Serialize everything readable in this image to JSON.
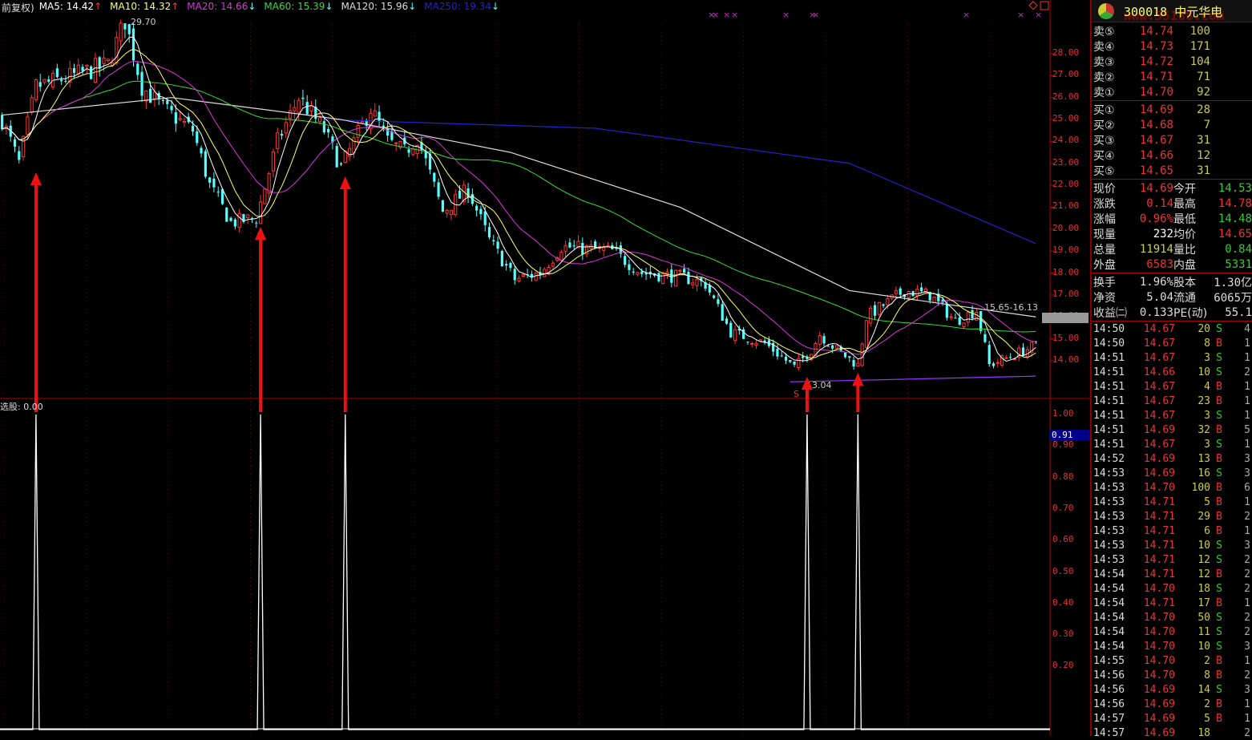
{
  "legend": {
    "prefix": "前复权)",
    "items": [
      {
        "label": "MA5: 14.42",
        "color": "#ffffff",
        "dir": "up"
      },
      {
        "label": "MA10: 14.32",
        "color": "#ffff66",
        "dir": "up"
      },
      {
        "label": "MA20: 14.66",
        "color": "#dd33dd",
        "dir": "down"
      },
      {
        "label": "MA60: 15.39",
        "color": "#33dd33",
        "dir": "down"
      },
      {
        "label": "MA120: 15.96",
        "color": "#dddddd",
        "dir": "down"
      },
      {
        "label": "MA250: 19.34",
        "color": "#2222cc",
        "dir": "down"
      }
    ]
  },
  "indicator": {
    "title": "选股: 0.00",
    "highlight": "0.91"
  },
  "annotations": {
    "high": "29.70",
    "low": "13.04",
    "range": "15.65-16.13",
    "s_marker": "S"
  },
  "chart_data": {
    "type": "candlestick",
    "price_axis": {
      "ticks": [
        28,
        27,
        26,
        25,
        24,
        23,
        22,
        21,
        20,
        19,
        18,
        17,
        16,
        15,
        14
      ],
      "labels": [
        "28.00",
        "27.00",
        "26.00",
        "25.00",
        "24.00",
        "23.00",
        "22.00",
        "21.00",
        "20.00",
        "19.00",
        "18.00",
        "17.00",
        "16.00",
        "15.00",
        "14.00"
      ]
    },
    "indicator_axis": {
      "ticks": [
        1,
        0.9,
        0.8,
        0.7,
        0.6,
        0.5,
        0.4,
        0.3,
        0.2
      ],
      "labels": [
        "1.00",
        "0.90",
        "0.80",
        "0.70",
        "0.60",
        "0.50",
        "0.40",
        "0.30",
        "0.20"
      ]
    },
    "candle_count": 245,
    "price_path": [
      [
        0,
        25
      ],
      [
        4,
        23
      ],
      [
        8,
        26.5
      ],
      [
        17,
        27
      ],
      [
        25,
        27.5
      ],
      [
        29,
        29.5
      ],
      [
        33,
        26.5
      ],
      [
        38,
        25.5
      ],
      [
        45,
        24.5
      ],
      [
        49,
        22
      ],
      [
        54,
        20.3
      ],
      [
        60,
        20.5
      ],
      [
        65,
        24
      ],
      [
        70,
        26
      ],
      [
        76,
        24.5
      ],
      [
        80,
        22.8
      ],
      [
        87,
        25.5
      ],
      [
        91,
        24
      ],
      [
        95,
        23.5
      ],
      [
        98,
        24.2
      ],
      [
        104,
        20.8
      ],
      [
        110,
        21.8
      ],
      [
        115,
        19.5
      ],
      [
        121,
        17.7
      ],
      [
        127,
        18
      ],
      [
        132,
        19.2
      ],
      [
        144,
        19
      ],
      [
        151,
        18
      ],
      [
        161,
        17.8
      ],
      [
        166,
        17.5
      ],
      [
        172,
        15.3
      ],
      [
        180,
        14.8
      ],
      [
        187,
        13.7
      ],
      [
        191,
        14.5
      ],
      [
        193,
        15.2
      ],
      [
        197,
        14.5
      ],
      [
        202,
        13.8
      ],
      [
        204,
        16
      ],
      [
        213,
        17.2
      ],
      [
        219,
        17
      ],
      [
        225,
        15.8
      ],
      [
        230,
        16.3
      ],
      [
        233,
        13.8
      ],
      [
        238,
        14.2
      ],
      [
        244,
        14.7
      ]
    ],
    "ma120_path": [
      [
        0,
        25.2
      ],
      [
        40,
        26
      ],
      [
        80,
        25
      ],
      [
        120,
        23.5
      ],
      [
        160,
        21
      ],
      [
        200,
        17.2
      ],
      [
        244,
        16
      ]
    ],
    "ma250_path": [
      [
        76,
        25
      ],
      [
        140,
        24.6
      ],
      [
        200,
        23
      ],
      [
        244,
        19.34
      ]
    ],
    "support_path": [
      [
        186,
        13.04
      ],
      [
        244,
        13.3
      ]
    ],
    "signal_indices": [
      8,
      61,
      81,
      190,
      202
    ],
    "signal_value": 1
  },
  "quote": {
    "title": "300018 中元华电",
    "watermark": "www.55188.com",
    "asks": [
      {
        "label": "卖⑤",
        "price": "14.74",
        "vol": "100"
      },
      {
        "label": "卖④",
        "price": "14.73",
        "vol": "171"
      },
      {
        "label": "卖③",
        "price": "14.72",
        "vol": "104"
      },
      {
        "label": "卖②",
        "price": "14.71",
        "vol": "71"
      },
      {
        "label": "卖①",
        "price": "14.70",
        "vol": "92"
      }
    ],
    "bids": [
      {
        "label": "买①",
        "price": "14.69",
        "vol": "28"
      },
      {
        "label": "买②",
        "price": "14.68",
        "vol": "7"
      },
      {
        "label": "买③",
        "price": "14.67",
        "vol": "31"
      },
      {
        "label": "买④",
        "price": "14.66",
        "vol": "12"
      },
      {
        "label": "买⑤",
        "price": "14.65",
        "vol": "31"
      }
    ],
    "stats": [
      {
        "l": "现价",
        "a": "14.69",
        "ac": "red",
        "l2": "今开",
        "b": "14.53",
        "bc": "grn"
      },
      {
        "l": "涨跌",
        "a": "0.14",
        "ac": "red",
        "l2": "最高",
        "b": "14.78",
        "bc": "red"
      },
      {
        "l": "涨幅",
        "a": "0.96%",
        "ac": "red",
        "l2": "最低",
        "b": "14.48",
        "bc": "grn"
      },
      {
        "l": "现量",
        "a": "232",
        "ac": "wht",
        "l2": "均价",
        "b": "14.65",
        "bc": "red"
      },
      {
        "l": "总量",
        "a": "11914",
        "ac": "yel",
        "l2": "量比",
        "b": "0.84",
        "bc": "grn"
      },
      {
        "l": "外盘",
        "a": "6583",
        "ac": "red",
        "l2": "内盘",
        "b": "5331",
        "bc": "grn"
      }
    ],
    "extra": [
      {
        "l": "换手",
        "a": "1.96%",
        "l2": "股本",
        "b": "1.30亿"
      },
      {
        "l": "净资",
        "a": "5.04",
        "l2": "流通",
        "b": "6065万"
      },
      {
        "l": "收益㈡",
        "a": "0.133",
        "l2": "PE(动)",
        "b": "55.1"
      }
    ],
    "trades": [
      [
        "14:50",
        "14.67",
        "20",
        "S",
        "4"
      ],
      [
        "14:50",
        "14.67",
        "8",
        "B",
        "1"
      ],
      [
        "14:51",
        "14.67",
        "3",
        "S",
        "1"
      ],
      [
        "14:51",
        "14.66",
        "10",
        "S",
        "2"
      ],
      [
        "14:51",
        "14.67",
        "4",
        "B",
        "1"
      ],
      [
        "14:51",
        "14.67",
        "23",
        "B",
        "1"
      ],
      [
        "14:51",
        "14.67",
        "3",
        "S",
        "1"
      ],
      [
        "14:51",
        "14.69",
        "32",
        "B",
        "5"
      ],
      [
        "14:51",
        "14.67",
        "3",
        "S",
        "1"
      ],
      [
        "14:52",
        "14.69",
        "13",
        "B",
        "3"
      ],
      [
        "14:53",
        "14.69",
        "16",
        "S",
        "3"
      ],
      [
        "14:53",
        "14.70",
        "100",
        "B",
        "6"
      ],
      [
        "14:53",
        "14.71",
        "5",
        "B",
        "1"
      ],
      [
        "14:53",
        "14.71",
        "29",
        "B",
        "2"
      ],
      [
        "14:53",
        "14.71",
        "6",
        "B",
        "1"
      ],
      [
        "14:53",
        "14.71",
        "10",
        "S",
        "3"
      ],
      [
        "14:53",
        "14.71",
        "12",
        "S",
        "2"
      ],
      [
        "14:54",
        "14.71",
        "12",
        "B",
        "2"
      ],
      [
        "14:54",
        "14.70",
        "18",
        "S",
        "2"
      ],
      [
        "14:54",
        "14.71",
        "17",
        "B",
        "1"
      ],
      [
        "14:54",
        "14.70",
        "50",
        "S",
        "2"
      ],
      [
        "14:54",
        "14.70",
        "11",
        "S",
        "2"
      ],
      [
        "14:54",
        "14.70",
        "10",
        "S",
        "3"
      ],
      [
        "14:55",
        "14.70",
        "2",
        "B",
        "1"
      ],
      [
        "14:56",
        "14.70",
        "8",
        "B",
        "2"
      ],
      [
        "14:56",
        "14.69",
        "14",
        "S",
        "3"
      ],
      [
        "14:56",
        "14.69",
        "2",
        "B",
        "1"
      ],
      [
        "14:57",
        "14.69",
        "5",
        "B",
        "1"
      ],
      [
        "14:57",
        "14.69",
        "18",
        "",
        "2"
      ]
    ]
  },
  "colors": {
    "up": "#ff3333",
    "down": "#54ffff",
    "divider": "#b00000",
    "arrow": "#ee1111"
  }
}
